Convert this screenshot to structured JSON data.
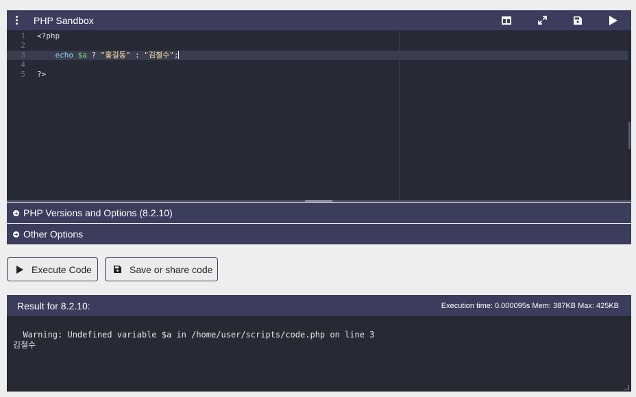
{
  "header": {
    "title": "PHP Sandbox",
    "icons": [
      "menu-icon",
      "split-layout-icon",
      "fullscreen-icon",
      "save-icon",
      "run-icon"
    ]
  },
  "editor": {
    "lines": [
      {
        "number": "1",
        "text": "<?php"
      },
      {
        "number": "2",
        "text": ""
      },
      {
        "number": "3",
        "text": "    echo $a ? \"홍길동\" : \"김철수\";"
      },
      {
        "number": "4",
        "text": ""
      },
      {
        "number": "5",
        "text": "?>"
      }
    ],
    "active_line": 3
  },
  "sections": {
    "versions_label": "PHP Versions and Options (8.2.10)",
    "other_label": "Other Options"
  },
  "buttons": {
    "execute_label": "Execute Code",
    "save_label": "Save or share code"
  },
  "result": {
    "title": "Result for 8.2.10:",
    "stats": "Execution time: 0.000095s Mem: 387KB Max: 425KB",
    "output": "Warning: Undefined variable $a in /home/user/scripts/code.php on line 3\n김철수"
  },
  "colors": {
    "header_bg": "#3c3c5c",
    "editor_bg": "#272935",
    "page_bg": "#eeeeee"
  }
}
